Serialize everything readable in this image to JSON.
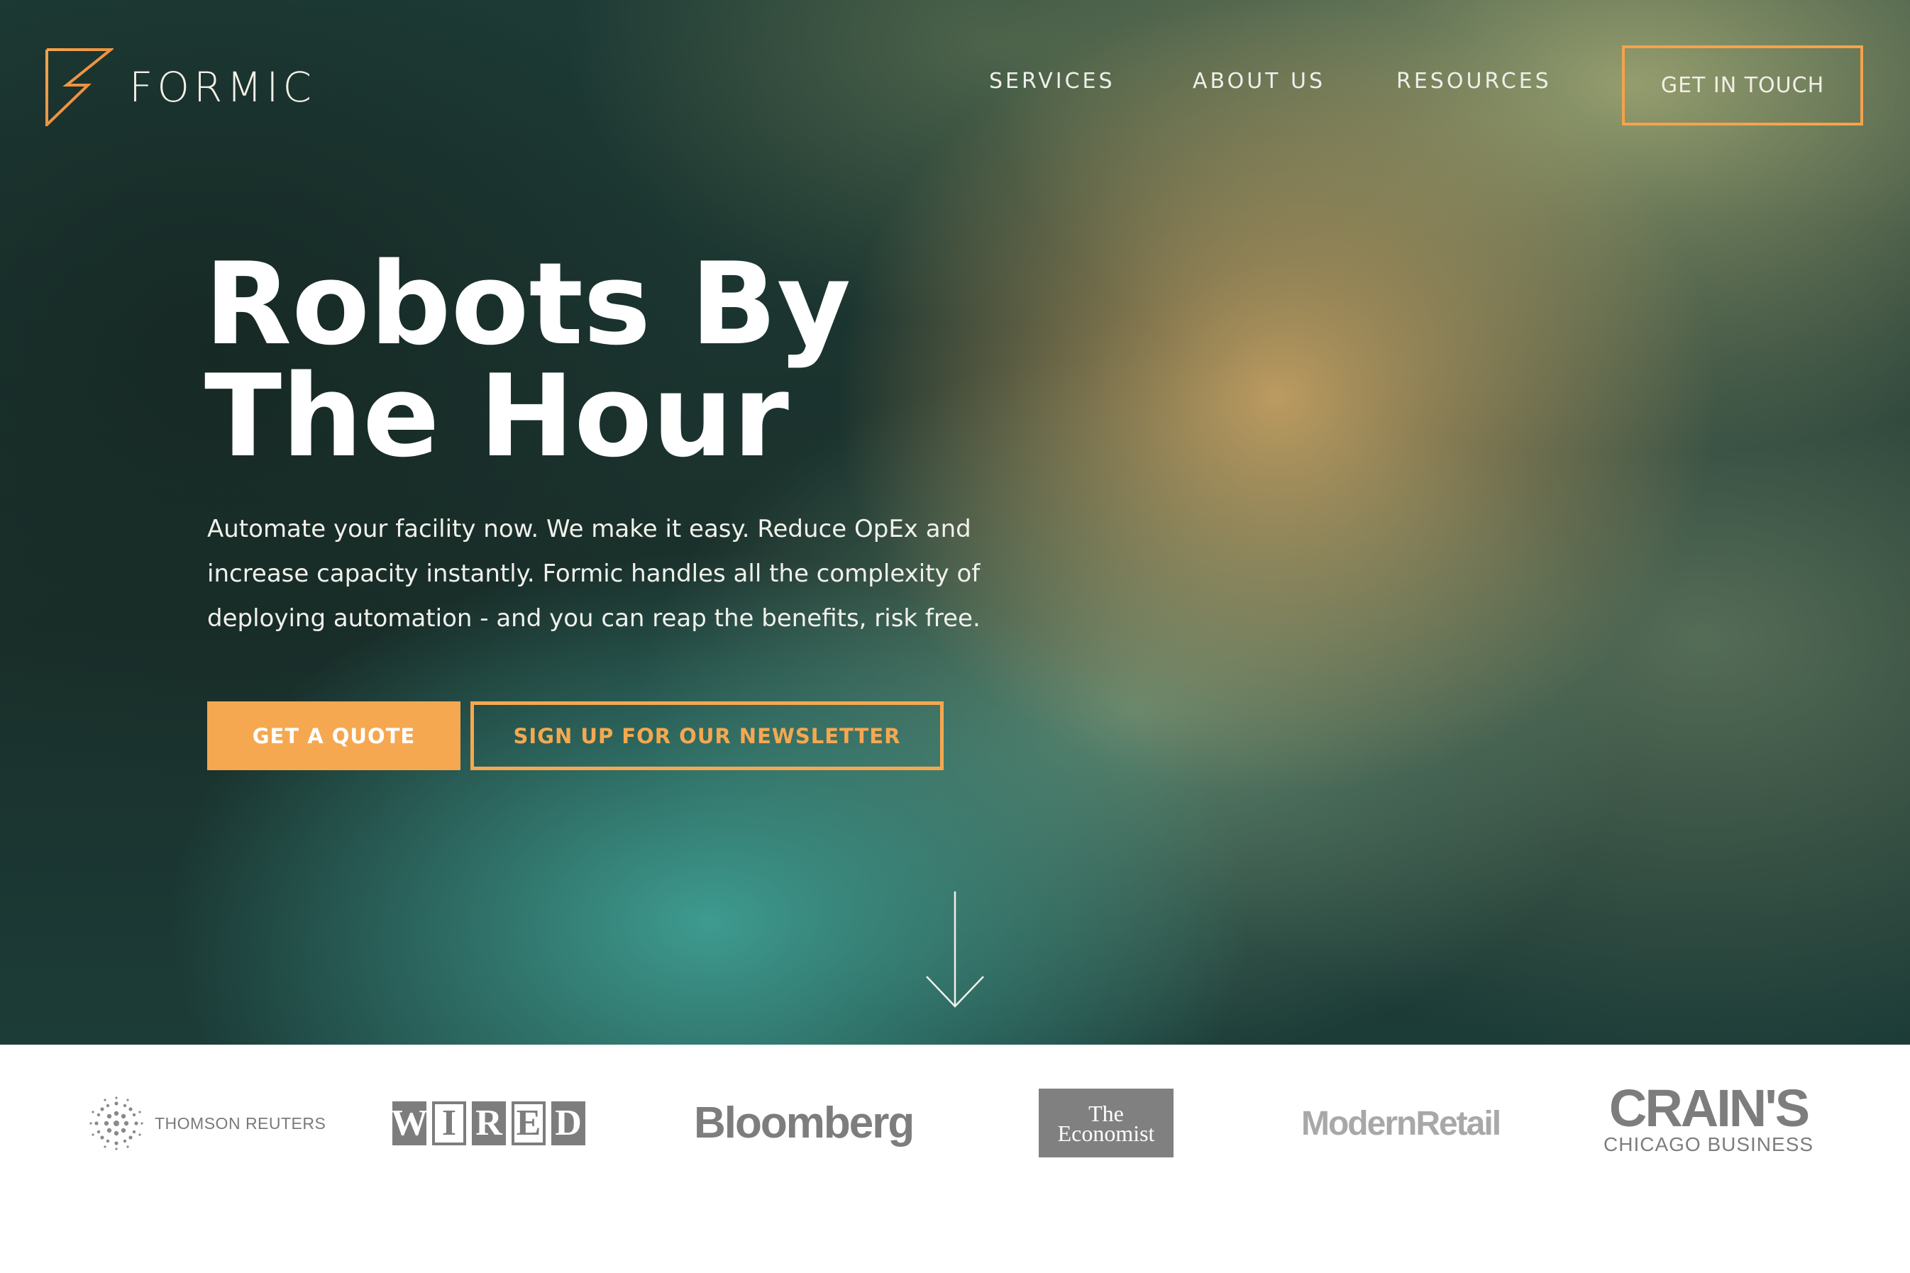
{
  "header": {
    "brand": "FORMIC",
    "nav": {
      "services": "SERVICES",
      "about": "ABOUT US",
      "resources": "RESOURCES"
    },
    "cta_label": "GET IN TOUCH"
  },
  "hero": {
    "headline_line1": "Robots By",
    "headline_line2": "The Hour",
    "subtext_line1": "Automate your facility now. We make it easy. Reduce OpEx and",
    "subtext_line2": "increase capacity instantly. Formic handles all the complexity of",
    "subtext_line3": "deploying automation - and you can reap the benefits, risk free.",
    "primary_button": "GET A QUOTE",
    "secondary_button": "SIGN UP FOR OUR NEWSLETTER",
    "scroll_icon": "arrow-down-icon"
  },
  "press": {
    "thomson_reuters": "THOMSON REUTERS",
    "wired_letters": [
      "W",
      "I",
      "R",
      "E",
      "D"
    ],
    "bloomberg": "Bloomberg",
    "economist_line1": "The",
    "economist_line2": "Economist",
    "modern_retail": "ModernRetail",
    "crains_big": "CRAIN'S",
    "crains_small": "CHICAGO BUSINESS"
  },
  "colors": {
    "accent": "#f5a850",
    "hero_dark": "#1a2f2a",
    "logo_gray": "#7d7d7d"
  }
}
